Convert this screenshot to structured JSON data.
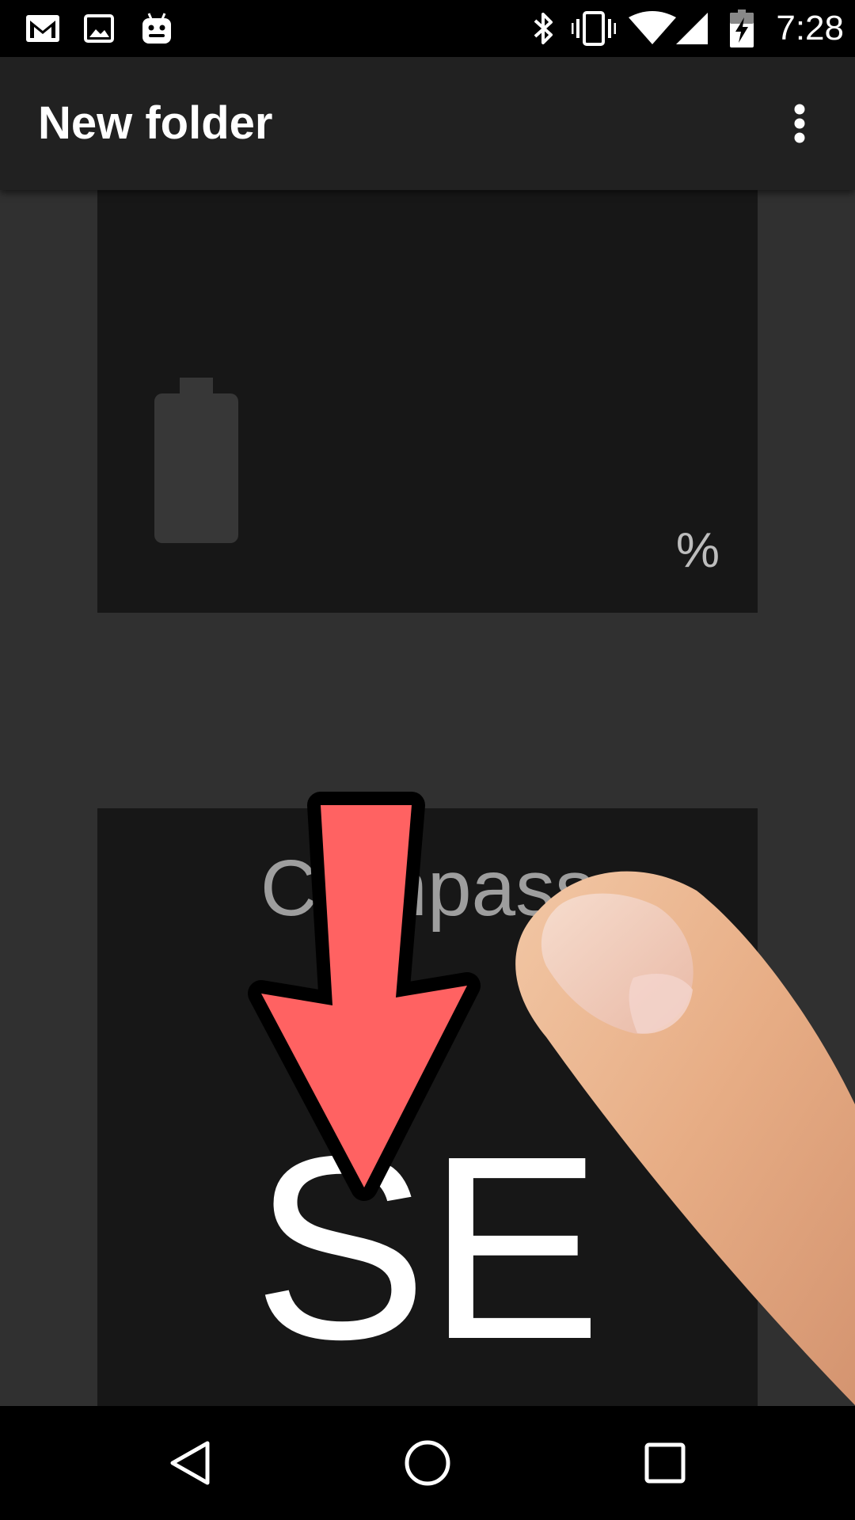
{
  "status_bar": {
    "time": "7:28",
    "left_icons": [
      "gmail-icon",
      "gallery-icon",
      "android-icon"
    ],
    "right_icons": [
      "bluetooth-icon",
      "vibrate-icon",
      "wifi-icon",
      "cell-signal-icon",
      "battery-charging-icon"
    ]
  },
  "app_bar": {
    "title": "New folder",
    "overflow_icon": "more-vert-icon"
  },
  "battery_widget": {
    "icon": "battery-icon",
    "percent_label": "%"
  },
  "compass_widget": {
    "title": "Compass",
    "heading": "SE"
  },
  "gesture_hint": {
    "arrow_icon": "swipe-down-arrow-icon",
    "hand_icon": "finger-icon",
    "arrow_color": "#ff6262"
  },
  "nav_bar": {
    "back_icon": "back-icon",
    "home_icon": "home-icon",
    "recents_icon": "recents-icon"
  }
}
